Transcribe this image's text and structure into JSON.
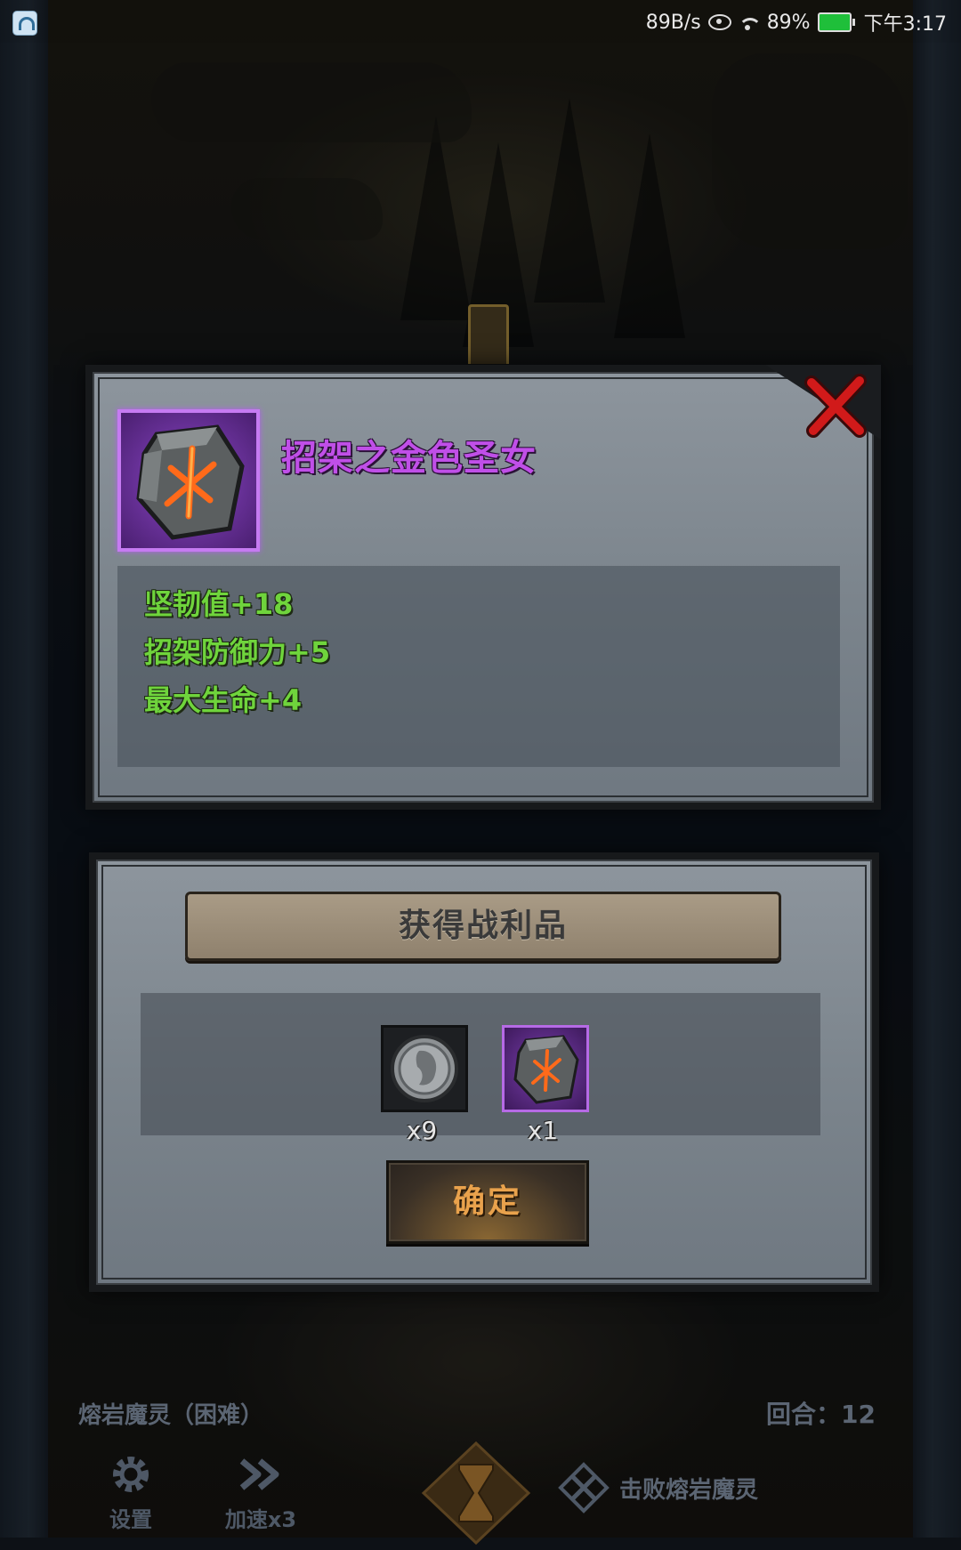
{
  "status_bar": {
    "speed": "89B/s",
    "battery": "89%",
    "time": "下午3:17",
    "icons": [
      "app-icon",
      "eye-icon",
      "wifi-icon",
      "battery-icon"
    ]
  },
  "item_popup": {
    "name": "招架之金色圣女",
    "icon": "rune-stone-icon",
    "rarity_color": "#c04fe8",
    "stats": [
      {
        "text": "坚韧值+18"
      },
      {
        "text": "招架防御力+5"
      },
      {
        "text": "最大生命+4"
      }
    ],
    "stat_color": "#6fd43c",
    "close_icon": "close-x-icon"
  },
  "loot_panel": {
    "title": "获得战利品",
    "items": [
      {
        "icon": "silver-coin-icon",
        "quantity": "x9"
      },
      {
        "icon": "rune-stone-icon",
        "quantity": "x1"
      }
    ],
    "confirm_label": "确定"
  },
  "hud": {
    "boss_name": "熔岩魔灵（困难）",
    "round": "回合：12",
    "buttons": [
      {
        "label": "设置",
        "icon": "gear-icon"
      },
      {
        "label": "加速x3",
        "icon": "fast-forward-icon"
      }
    ],
    "center_icon": "hourglass-icon",
    "goal": "击败熔岩魔灵",
    "goal_icon": "crossed-swords-icon"
  }
}
